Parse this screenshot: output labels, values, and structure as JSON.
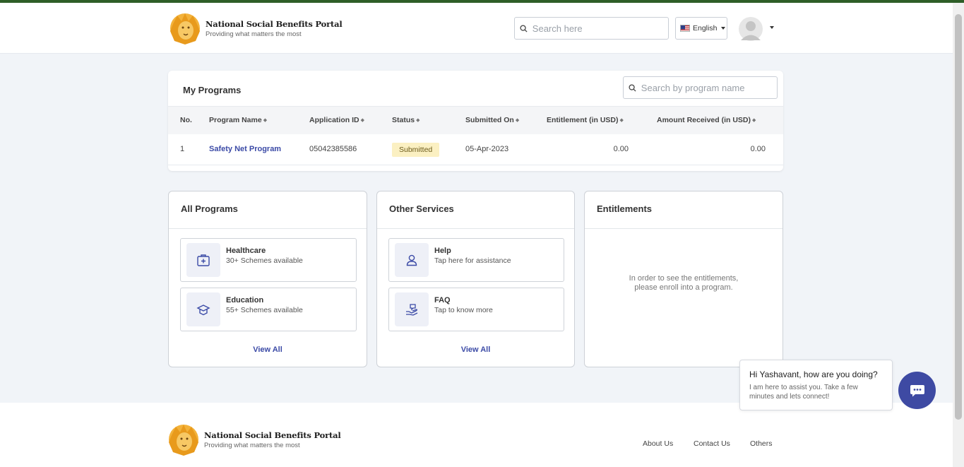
{
  "colors": {
    "top_accent": "#2e5e28",
    "link": "#3b4aa6",
    "chat": "#3e4aa3",
    "badge_bg": "#fbf0c2"
  },
  "brand": {
    "title": "National Social Benefits Portal",
    "tagline": "Providing what matters the most",
    "logo_icon": "lion-logo-icon"
  },
  "header": {
    "search_placeholder": "Search here",
    "language": "English",
    "flag_icon": "us-flag-icon",
    "avatar_icon": "user-avatar-icon"
  },
  "my_programs": {
    "title": "My Programs",
    "search_placeholder": "Search by program name",
    "columns": [
      "No.",
      "Program Name",
      "Application ID",
      "Status",
      "Submitted On",
      "Entitlement (in USD)",
      "Amount Received (in USD)"
    ],
    "rows": [
      {
        "no": "1",
        "program": "Safety Net Program",
        "app_id": "05042385586",
        "status": "Submitted",
        "submitted_on": "05-Apr-2023",
        "entitlement": "0.00",
        "received": "0.00"
      }
    ]
  },
  "all_programs": {
    "title": "All Programs",
    "items": [
      {
        "name": "Healthcare",
        "sub": "30+ Schemes available",
        "icon": "medical-kit-icon"
      },
      {
        "name": "Education",
        "sub": "55+ Schemes available",
        "icon": "graduation-cap-icon"
      }
    ],
    "view_all": "View All"
  },
  "other_services": {
    "title": "Other Services",
    "items": [
      {
        "name": "Help",
        "sub": "Tap here for assistance",
        "icon": "person-icon"
      },
      {
        "name": "FAQ",
        "sub": "Tap to know more",
        "icon": "faq-hand-icon"
      }
    ],
    "view_all": "View All"
  },
  "entitlements": {
    "title": "Entitlements",
    "line1": "In order to see the entitlements,",
    "line2": "please enroll into a program."
  },
  "footer": {
    "links": [
      "About Us",
      "Contact Us",
      "Others"
    ]
  },
  "chat": {
    "greeting": "Hi Yashavant, how are you doing?",
    "message": "I am here to assist you. Take a few minutes and lets connect!",
    "icon": "chat-bubble-icon"
  }
}
